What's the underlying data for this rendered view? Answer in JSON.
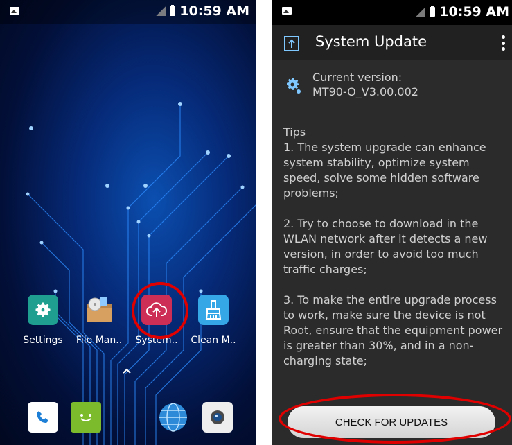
{
  "home": {
    "status_time": "10:59 AM",
    "apps": [
      {
        "label": "Settings",
        "icon": "gear-icon",
        "color": "#1e9f8f"
      },
      {
        "label": "File Man..",
        "icon": "file-manager-icon",
        "color": "#d8a060"
      },
      {
        "label": "System..",
        "icon": "cloud-upload-icon",
        "color": "#cc2e55"
      },
      {
        "label": "Clean M..",
        "icon": "broom-icon",
        "color": "#35a6e6"
      }
    ],
    "dock": [
      "phone-icon",
      "messaging-icon",
      "browser-icon",
      "camera-icon"
    ]
  },
  "update": {
    "status_time": "10:59 AM",
    "title": "System Update",
    "current_version_label": "Current version:",
    "current_version": "MT90-O_V3.00.002",
    "tips_heading": "Tips",
    "tips": [
      "1. The system upgrade can enhance system stability, optimize system speed, solve some hidden software problems;",
      " 2. Try to choose to download in the WLAN network after it detects a new version, in order to avoid too much traffic charges;",
      " 3. To make the entire upgrade process to work, make sure the device is not Root, ensure that the equipment power is greater than 30%, and in a non-charging state;"
    ],
    "button_label": "CHECK FOR UPDATES"
  },
  "colors": {
    "highlight": "#e00000",
    "update_bg": "#2b2b2b"
  }
}
